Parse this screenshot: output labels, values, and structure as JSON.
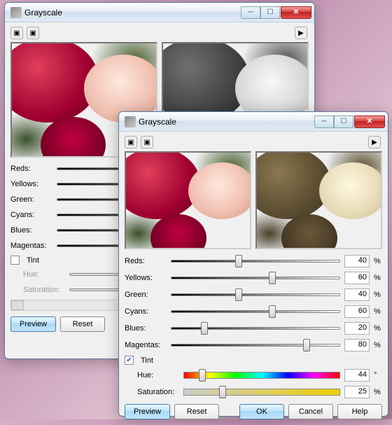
{
  "dialog1": {
    "title": "Grayscale",
    "sliders": {
      "reds": "Reds:",
      "yellows": "Yellows:",
      "green": "Green:",
      "cyans": "Cyans:",
      "blues": "Blues:",
      "magentas": "Magentas:"
    },
    "tint_label": "Tint",
    "tint_checked": false,
    "hue_label": "Hue:",
    "saturation_label": "Saturation:",
    "buttons": {
      "preview": "Preview",
      "reset": "Reset"
    }
  },
  "dialog2": {
    "title": "Grayscale",
    "sliders": [
      {
        "label": "Reds:",
        "value": 40,
        "unit": "%"
      },
      {
        "label": "Yellows:",
        "value": 60,
        "unit": "%"
      },
      {
        "label": "Green:",
        "value": 40,
        "unit": "%"
      },
      {
        "label": "Cyans:",
        "value": 60,
        "unit": "%"
      },
      {
        "label": "Blues:",
        "value": 20,
        "unit": "%"
      },
      {
        "label": "Magentas:",
        "value": 80,
        "unit": "%"
      }
    ],
    "tint_label": "Tint",
    "tint_checked": true,
    "hue": {
      "label": "Hue:",
      "value": 44,
      "unit": "°"
    },
    "saturation": {
      "label": "Saturation:",
      "value": 25,
      "unit": "%"
    },
    "buttons": {
      "preview": "Preview",
      "reset": "Reset",
      "ok": "OK",
      "cancel": "Cancel",
      "help": "Help"
    }
  }
}
